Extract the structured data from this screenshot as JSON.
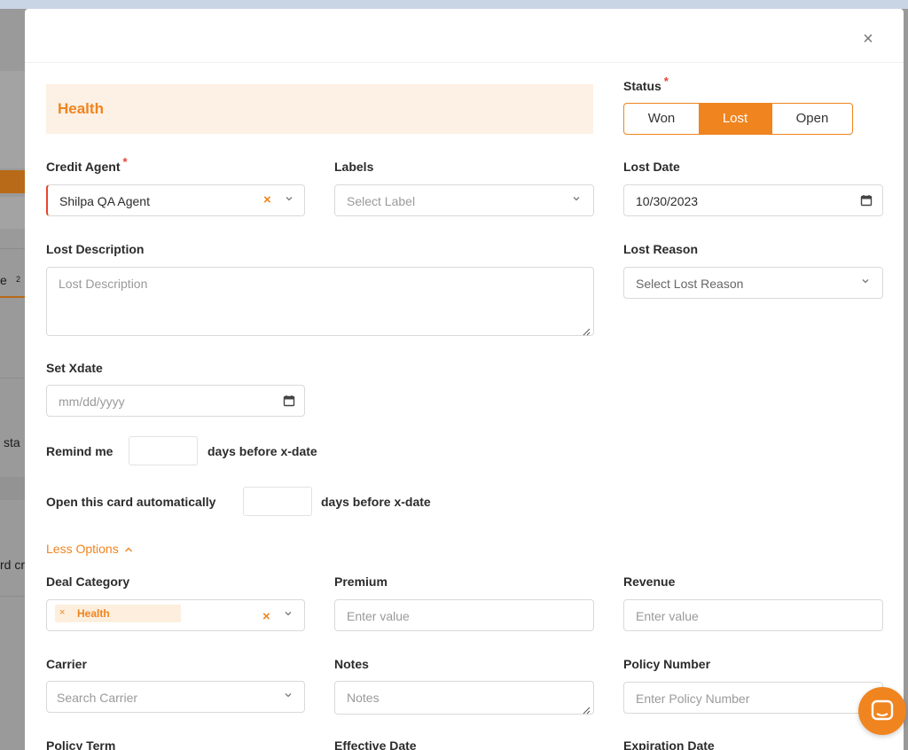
{
  "background": {
    "left_labels": [
      "e",
      "2",
      "sta",
      "rd cr"
    ]
  },
  "modal": {
    "close_symbol": "×",
    "section_title": "Health",
    "status": {
      "label": "Status",
      "required_mark": "*",
      "options": [
        "Won",
        "Lost",
        "Open"
      ],
      "selected": "Lost"
    },
    "credit_agent": {
      "label": "Credit Agent",
      "required_mark": "*",
      "value": "Shilpa QA Agent"
    },
    "labels_field": {
      "label": "Labels",
      "placeholder": "Select Label"
    },
    "lost_date": {
      "label": "Lost Date",
      "value": "10/30/2023"
    },
    "lost_description": {
      "label": "Lost Description",
      "placeholder": "Lost Description"
    },
    "lost_reason": {
      "label": "Lost Reason",
      "placeholder": "Select Lost Reason"
    },
    "set_xdate": {
      "label": "Set Xdate",
      "placeholder": "mm/dd/yyyy"
    },
    "remind": {
      "prefix": "Remind me",
      "suffix": "days before x-date"
    },
    "open_card": {
      "prefix": "Open this card automatically",
      "suffix": "days before x-date"
    },
    "less_options": "Less Options",
    "deal_category": {
      "label": "Deal Category",
      "tag": "Health",
      "tag_remove": "×"
    },
    "premium": {
      "label": "Premium",
      "placeholder": "Enter value"
    },
    "revenue": {
      "label": "Revenue",
      "placeholder": "Enter value"
    },
    "carrier": {
      "label": "Carrier",
      "placeholder": "Search Carrier"
    },
    "notes": {
      "label": "Notes",
      "placeholder": "Notes"
    },
    "policy_number": {
      "label": "Policy Number",
      "placeholder": "Enter Policy Number"
    },
    "bottom_labels": [
      "Policy Term",
      "Effective Date",
      "Expiration Date"
    ]
  },
  "colors": {
    "accent": "#f0841f",
    "banner_bg": "#fdf0e4",
    "required": "#e8442e"
  }
}
